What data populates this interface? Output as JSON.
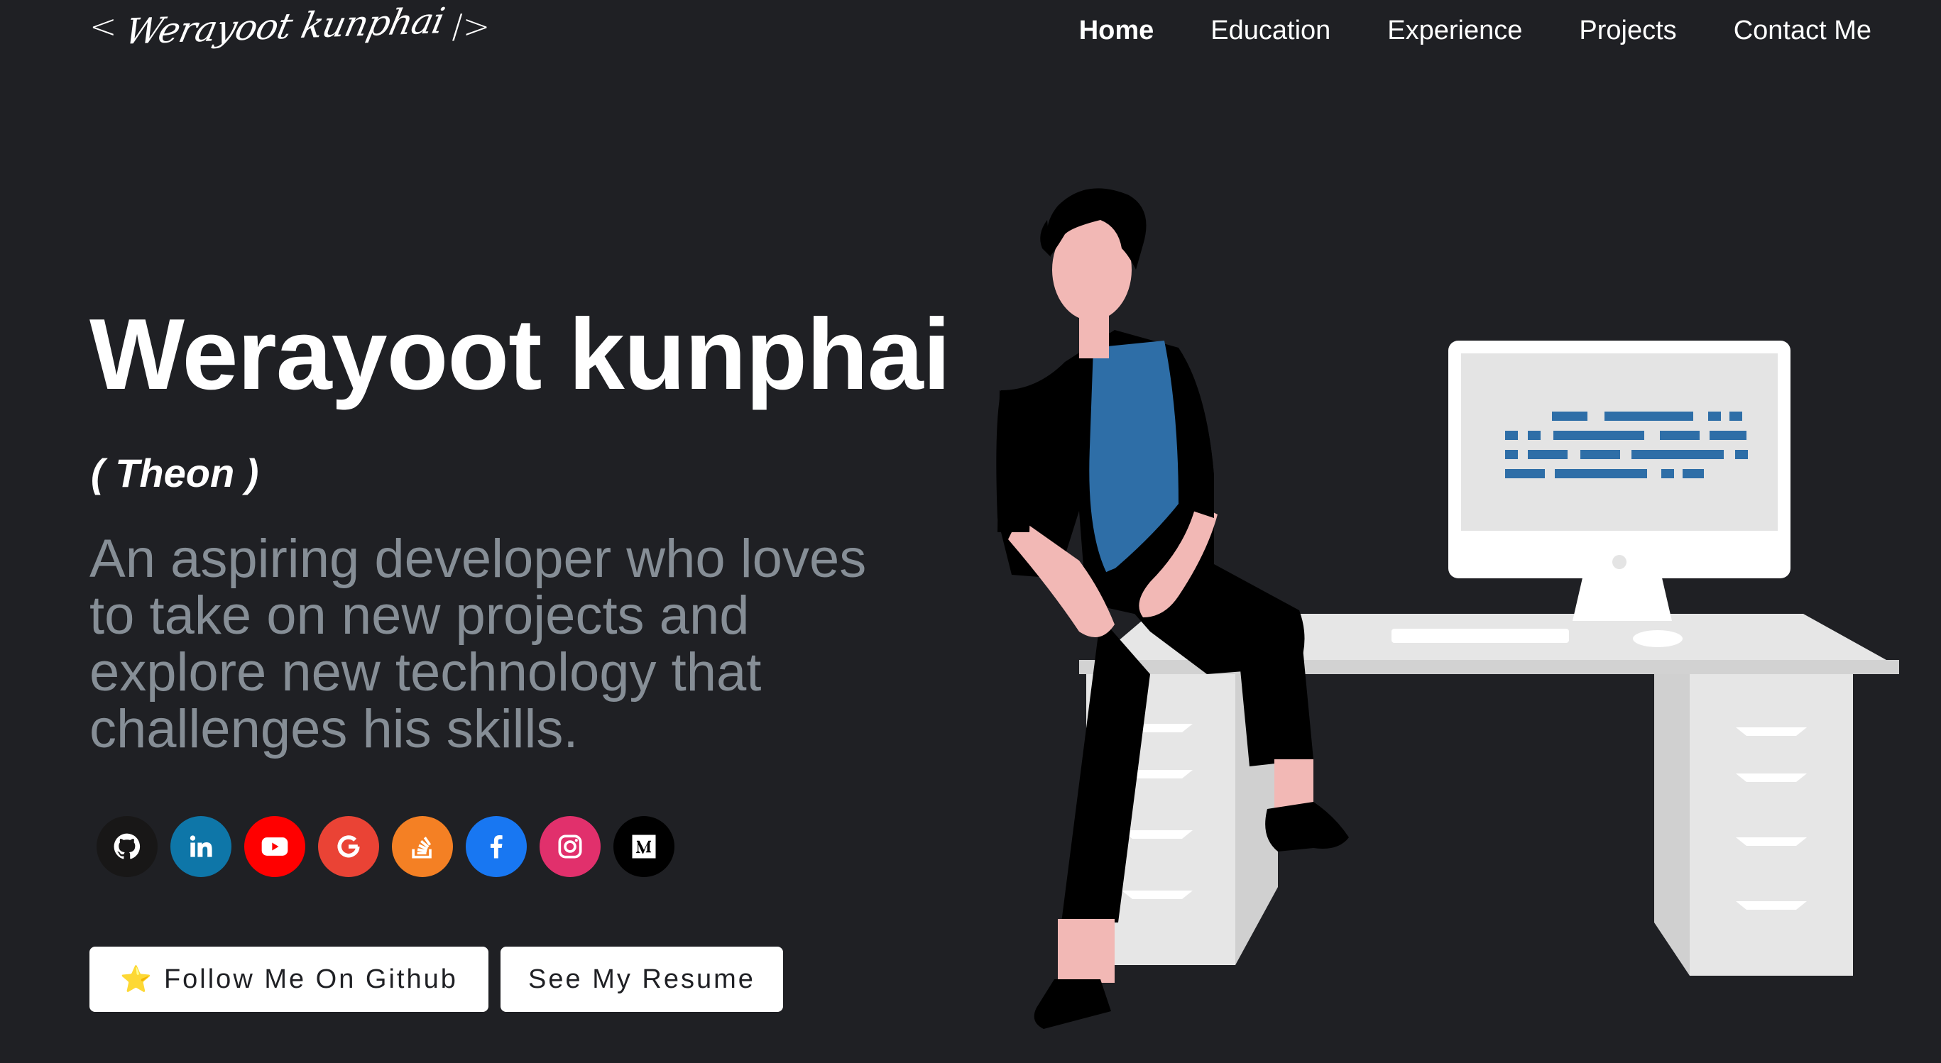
{
  "header": {
    "logo_open": "<",
    "logo_name": "Werayoot kunphai",
    "logo_close": "/>",
    "nav": [
      {
        "label": "Home",
        "active": true
      },
      {
        "label": "Education",
        "active": false
      },
      {
        "label": "Experience",
        "active": false
      },
      {
        "label": "Projects",
        "active": false
      },
      {
        "label": "Contact Me",
        "active": false
      }
    ]
  },
  "hero": {
    "name": "Werayoot kunphai",
    "nickname": "( Theon )",
    "tagline": "An aspiring developer who loves to take on new projects and explore new technology that challenges his skills."
  },
  "socials": [
    {
      "icon": "github-icon",
      "color": "#181717"
    },
    {
      "icon": "linkedin-icon",
      "color": "#0e76a8"
    },
    {
      "icon": "youtube-icon",
      "color": "#f00"
    },
    {
      "icon": "google-icon",
      "color": "#ea4335"
    },
    {
      "icon": "stackoverflow-icon",
      "color": "#f48024"
    },
    {
      "icon": "facebook-icon",
      "color": "#1877f2"
    },
    {
      "icon": "instagram-icon",
      "color": "#e1306c"
    },
    {
      "icon": "medium-icon",
      "color": "#000000"
    }
  ],
  "buttons": {
    "github_star": "⭐",
    "github_label": "Follow Me On Github",
    "resume_label": "See My Resume"
  },
  "colors": {
    "background": "#1f2024",
    "tagline": "#868e96",
    "illustration_accent": "#2e6ea7"
  }
}
